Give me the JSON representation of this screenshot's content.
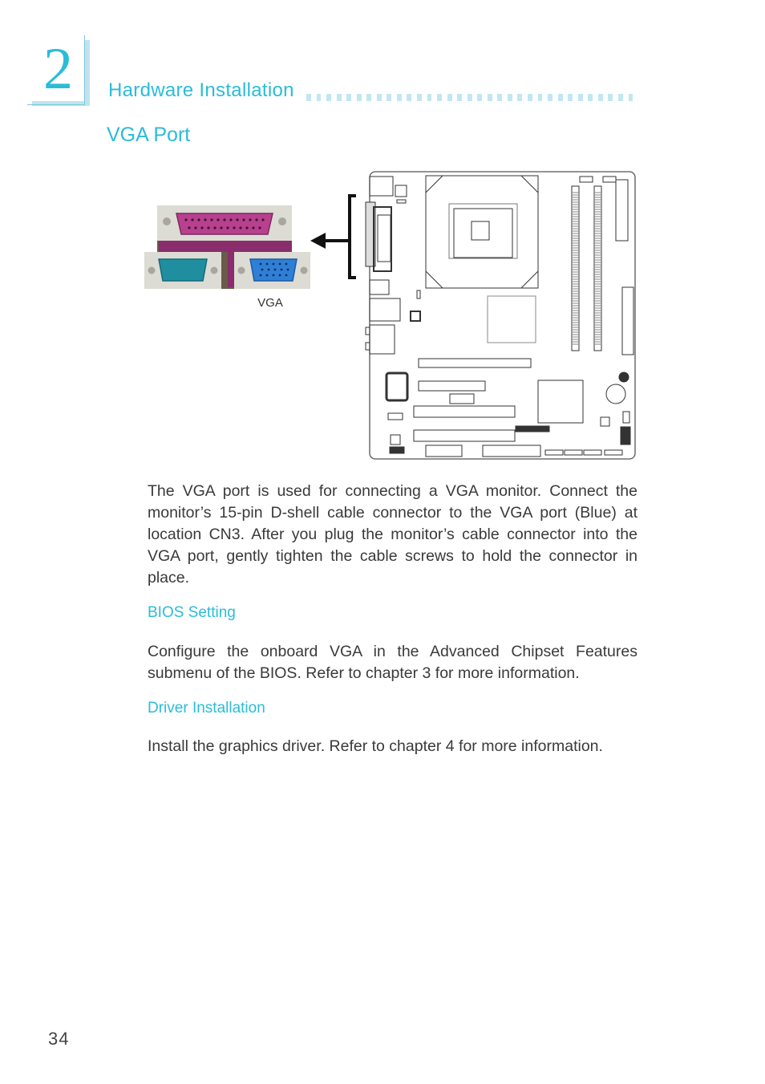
{
  "chapter": {
    "number": "2",
    "section_title": "Hardware Installation"
  },
  "page_title": "VGA Port",
  "figure": {
    "connector_label": "VGA",
    "colors": {
      "parallel_port": "#b8408f",
      "serial_port": "#1f8fa0",
      "vga_port": "#2f7fd6",
      "accent": "#2bbcd8"
    }
  },
  "paragraphs": {
    "intro": "The VGA port is used for connecting a VGA monitor. Connect the monitor’s 15-pin D-shell cable connector to the VGA port (Blue) at location CN3. After you plug the monitor’s cable connector into the VGA port, gently tighten the cable screws to hold the connector in place.",
    "bios": "Configure the onboard VGA in the Advanced Chipset Features submenu of the BIOS. Refer to chapter 3 for more information.",
    "driver": "Install the graphics driver. Refer to chapter 4 for more information."
  },
  "subheadings": {
    "bios": "BIOS Setting",
    "driver": "Driver Installation"
  },
  "page_number": "34"
}
